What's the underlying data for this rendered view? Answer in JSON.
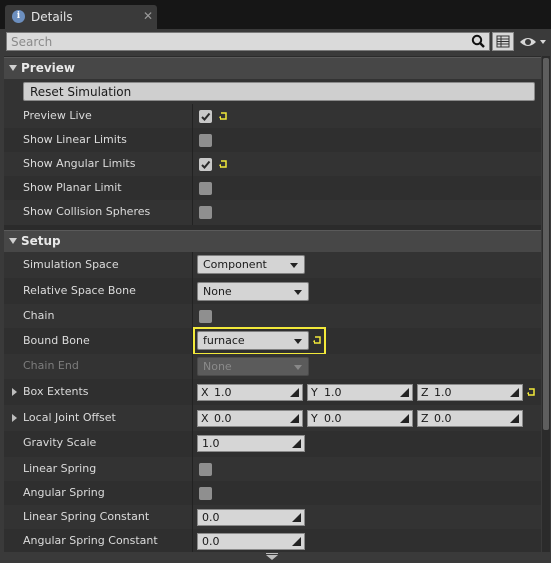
{
  "tab": {
    "title": "Details",
    "close": "✕",
    "icon": "info-icon"
  },
  "search": {
    "placeholder": "Search",
    "value": ""
  },
  "toolbar": {
    "search_icon": "magnifier-icon",
    "view_icon": "property-matrix-icon",
    "eye_icon": "eye-icon"
  },
  "colors": {
    "highlight": "#f2e93a",
    "panel": "#3a3a3a",
    "row": "#333333",
    "category": "#474747"
  },
  "preview": {
    "header": "Preview",
    "reset_button": "Reset Simulation",
    "rows": [
      {
        "label": "Preview Live",
        "checked": true,
        "highlighted": true,
        "reset": true
      },
      {
        "label": "Show Linear Limits",
        "checked": false
      },
      {
        "label": "Show Angular Limits",
        "checked": true,
        "highlighted": true,
        "reset": true
      },
      {
        "label": "Show Planar Limit",
        "checked": false
      },
      {
        "label": "Show Collision Spheres",
        "checked": false
      }
    ]
  },
  "setup": {
    "header": "Setup",
    "simulation_space": {
      "label": "Simulation Space",
      "value": "Component"
    },
    "relative_space_bone": {
      "label": "Relative Space Bone",
      "value": "None"
    },
    "chain": {
      "label": "Chain",
      "checked": false
    },
    "bound_bone": {
      "label": "Bound Bone",
      "value": "furnace"
    },
    "chain_end": {
      "label": "Chain End",
      "value": "None"
    },
    "box_extents": {
      "label": "Box Extents",
      "x_axis": "X",
      "y_axis": "Y",
      "z_axis": "Z",
      "x": "1.0",
      "y": "1.0",
      "z": "1.0"
    },
    "local_joint_offset": {
      "label": "Local Joint Offset",
      "x_axis": "X",
      "y_axis": "Y",
      "z_axis": "Z",
      "x": "0.0",
      "y": "0.0",
      "z": "0.0"
    },
    "gravity_scale": {
      "label": "Gravity Scale",
      "value": "1.0"
    },
    "linear_spring": {
      "label": "Linear Spring",
      "checked": false
    },
    "angular_spring": {
      "label": "Angular Spring",
      "checked": false
    },
    "linear_spring_constant": {
      "label": "Linear Spring Constant",
      "value": "0.0"
    },
    "angular_spring_constant": {
      "label": "Angular Spring Constant",
      "value": "0.0"
    }
  }
}
